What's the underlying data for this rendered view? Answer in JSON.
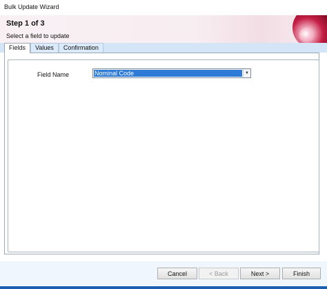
{
  "window": {
    "title": "Bulk Update Wizard"
  },
  "header": {
    "step": "Step 1 of 3",
    "subtitle": "Select a field to update"
  },
  "tabs": [
    {
      "label": "Fields",
      "active": true
    },
    {
      "label": "Values",
      "active": false
    },
    {
      "label": "Confirmation",
      "active": false
    }
  ],
  "form": {
    "field_name_label": "Field Name",
    "field_name_value": "Nominal Code",
    "dropdown_icon": "chevron-down-icon"
  },
  "buttons": {
    "cancel": "Cancel",
    "back": "< Back",
    "next": "Next >",
    "finish": "Finish"
  },
  "colors": {
    "selection": "#2d7bd6",
    "footer_bg": "#f0f6fd",
    "tab_bg": "#dcebfb"
  }
}
